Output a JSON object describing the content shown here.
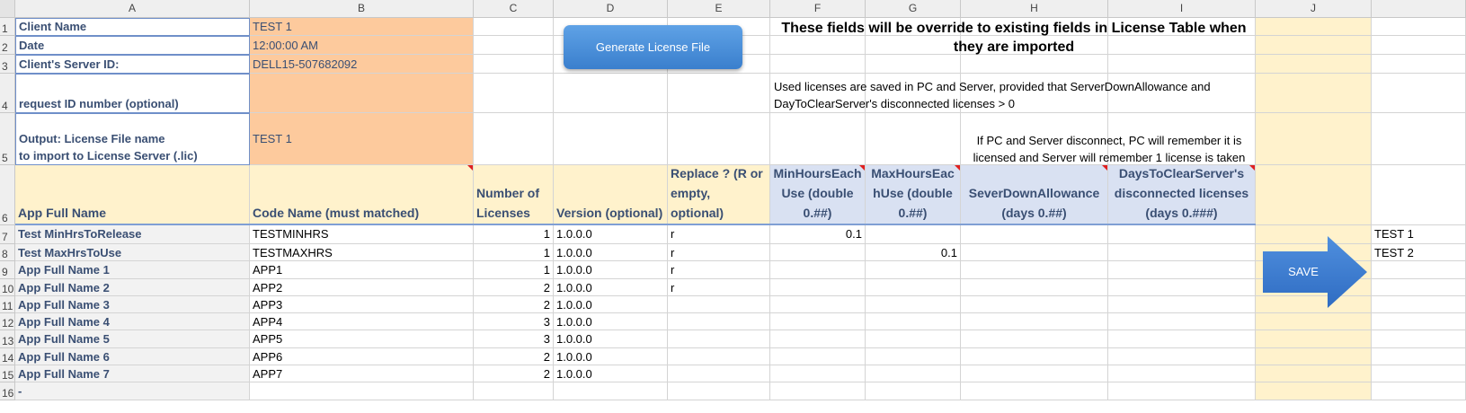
{
  "columns": [
    "A",
    "B",
    "C",
    "D",
    "E",
    "F",
    "G",
    "H",
    "I",
    "J"
  ],
  "row_numbers": [
    "1",
    "2",
    "3",
    "4",
    "5",
    "6",
    "7",
    "8",
    "9",
    "10",
    "11",
    "12",
    "13",
    "14",
    "15",
    "16"
  ],
  "form": {
    "client_name_label": "Client Name",
    "client_name_value": "TEST 1",
    "date_label": "Date",
    "date_value": "12:00:00 AM",
    "server_id_label": "Client's Server ID:",
    "server_id_value": "DELL15-507682092",
    "request_id_label": "request ID number (optional)",
    "request_id_value": "",
    "output_label_1": "Output: License File name",
    "output_label_2": "to import to License Server (.lic)",
    "output_value": "TEST 1"
  },
  "buttons": {
    "generate": "Generate License File",
    "save": "SAVE"
  },
  "notes": {
    "override": "These fields will be override to existing fields in License Table when they are imported",
    "used_licenses": "Used licenses are saved in PC and Server, provided that ServerDownAllowance and DayToClearServer's disconnected licenses > 0",
    "pc_server": "If PC and Server disconnect, PC will remember it is licensed and Server will remember 1 license is taken"
  },
  "table_headers": {
    "app_full_name": "App Full Name",
    "code_name": "Code Name (must matched)",
    "num_licenses": "Number of Licenses",
    "version": "Version (optional)",
    "replace": "Replace ? (R or empty, optional)",
    "min_hours": "MinHoursEach Use (double 0.##)",
    "max_hours": "MaxHoursEac hUse (double 0.##)",
    "server_down": "SeverDownAllowance (days 0.##)",
    "days_clear": "DaysToClearServer's disconnected licenses (days 0.###)"
  },
  "rows": [
    {
      "app": "Test MinHrsToRelease",
      "code": "TESTMINHRS",
      "num": "1",
      "version": "1.0.0.0",
      "replace": "r",
      "min": "0.1",
      "max": "",
      "down": "",
      "clear": ""
    },
    {
      "app": "Test MaxHrsToUse",
      "code": "TESTMAXHRS",
      "num": "1",
      "version": "1.0.0.0",
      "replace": "r",
      "min": "",
      "max": "0.1",
      "down": "",
      "clear": ""
    },
    {
      "app": "App Full Name 1",
      "code": "APP1",
      "num": "1",
      "version": "1.0.0.0",
      "replace": "r",
      "min": "",
      "max": "",
      "down": "",
      "clear": ""
    },
    {
      "app": "App Full Name 2",
      "code": "APP2",
      "num": "2",
      "version": "1.0.0.0",
      "replace": "r",
      "min": "",
      "max": "",
      "down": "",
      "clear": ""
    },
    {
      "app": "App Full Name 3",
      "code": "APP3",
      "num": "2",
      "version": "1.0.0.0",
      "replace": "",
      "min": "",
      "max": "",
      "down": "",
      "clear": ""
    },
    {
      "app": "App Full Name 4",
      "code": "APP4",
      "num": "3",
      "version": "1.0.0.0",
      "replace": "",
      "min": "",
      "max": "",
      "down": "",
      "clear": ""
    },
    {
      "app": "App Full Name 5",
      "code": "APP5",
      "num": "3",
      "version": "1.0.0.0",
      "replace": "",
      "min": "",
      "max": "",
      "down": "",
      "clear": ""
    },
    {
      "app": "App Full Name 6",
      "code": "APP6",
      "num": "2",
      "version": "1.0.0.0",
      "replace": "",
      "min": "",
      "max": "",
      "down": "",
      "clear": ""
    },
    {
      "app": "App Full Name 7",
      "code": "APP7",
      "num": "2",
      "version": "1.0.0.0",
      "replace": "",
      "min": "",
      "max": "",
      "down": "",
      "clear": ""
    },
    {
      "app": "-",
      "code": "",
      "num": "",
      "version": "",
      "replace": "",
      "min": "",
      "max": "",
      "down": "",
      "clear": ""
    }
  ],
  "right_column": [
    "TEST 1",
    "TEST 2"
  ],
  "colors": {
    "orange_fill": "#fdca9d",
    "cream_fill": "#fff2cc",
    "lavender_fill": "#d9e1f2",
    "label_text": "#3a4f73",
    "button_blue": "#3a7fcd",
    "comment_marker": "#e02020"
  }
}
